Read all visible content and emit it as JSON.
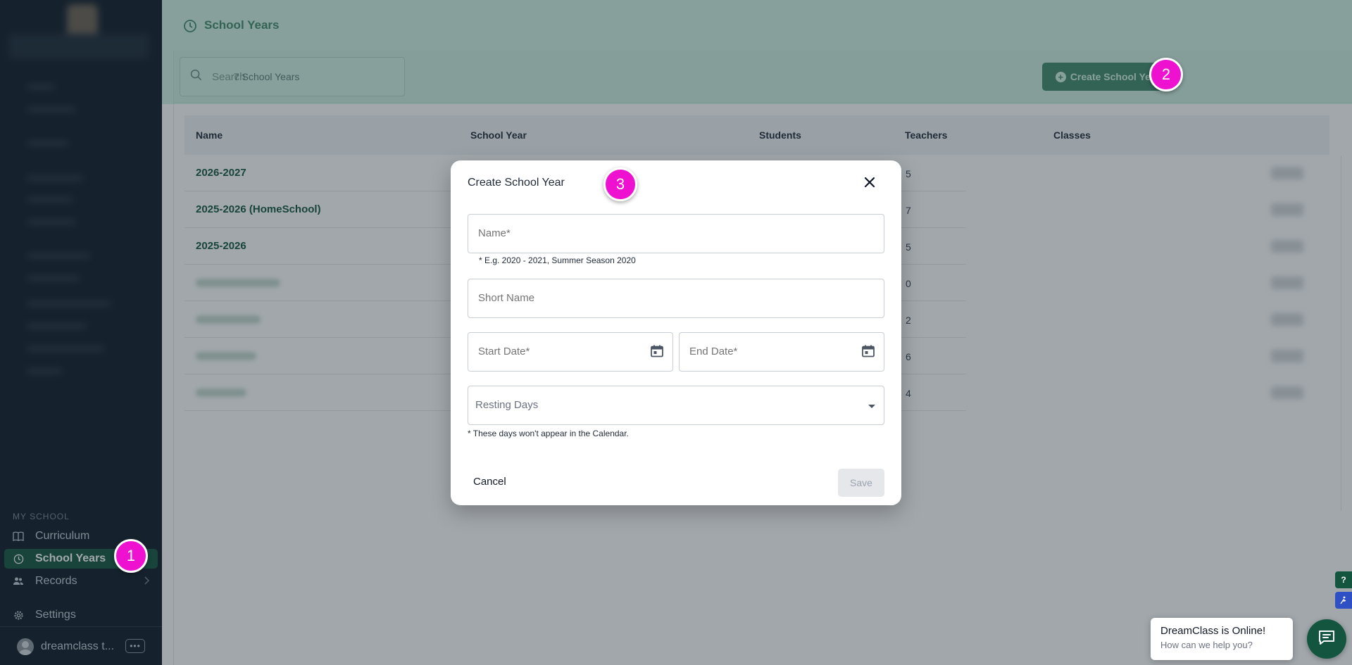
{
  "sidebar": {
    "section_label": "MY SCHOOL",
    "items": [
      {
        "label": "Curriculum"
      },
      {
        "label": "School Years"
      },
      {
        "label": "Records"
      },
      {
        "label": "Settings"
      }
    ],
    "user_name": "dreamclass t...",
    "more_label": "•••"
  },
  "header": {
    "title": "School Years"
  },
  "toolbar": {
    "search_placeholder": "Search",
    "count_text": "7 School Years",
    "create_label": "Create School Year"
  },
  "table": {
    "columns": [
      "Name",
      "School Year",
      "Students",
      "Teachers",
      "Classes"
    ],
    "rows": [
      {
        "name": "2026-2027",
        "teachers": "5"
      },
      {
        "name": "2025-2026 (HomeSchool)",
        "teachers": "7"
      },
      {
        "name": "2025-2026",
        "teachers": "5"
      },
      {
        "name": "",
        "teachers": "0"
      },
      {
        "name": "",
        "teachers": "2"
      },
      {
        "name": "",
        "teachers": "6"
      },
      {
        "name": "",
        "teachers": "4"
      }
    ]
  },
  "modal": {
    "title": "Create School Year",
    "name_placeholder": "Name*",
    "name_hint": "* E.g. 2020 - 2021, Summer Season 2020",
    "short_name_placeholder": "Short Name",
    "start_date_placeholder": "Start Date*",
    "end_date_placeholder": "End Date*",
    "resting_days_placeholder": "Resting Days",
    "resting_hint": "* These days won't appear in the Calendar.",
    "cancel_label": "Cancel",
    "save_label": "Save"
  },
  "steps": [
    "1",
    "2",
    "3"
  ],
  "widgets": {
    "help_label": "?",
    "chat_title": "DreamClass is Online!",
    "chat_subtitle": "How can we help you?"
  },
  "colors": {
    "brand": "#14553f",
    "sidebar_bg": "#0f1a27",
    "badge": "#ee11d0",
    "save_disabled": "#e5e7eb"
  },
  "icons": {
    "curriculum": "book-icon",
    "school_years": "clock-icon",
    "records": "people-icon",
    "settings": "gear-icon",
    "search": "search-icon",
    "close": "close-icon",
    "calendar": "calendar-icon",
    "chat": "chat-icon"
  }
}
